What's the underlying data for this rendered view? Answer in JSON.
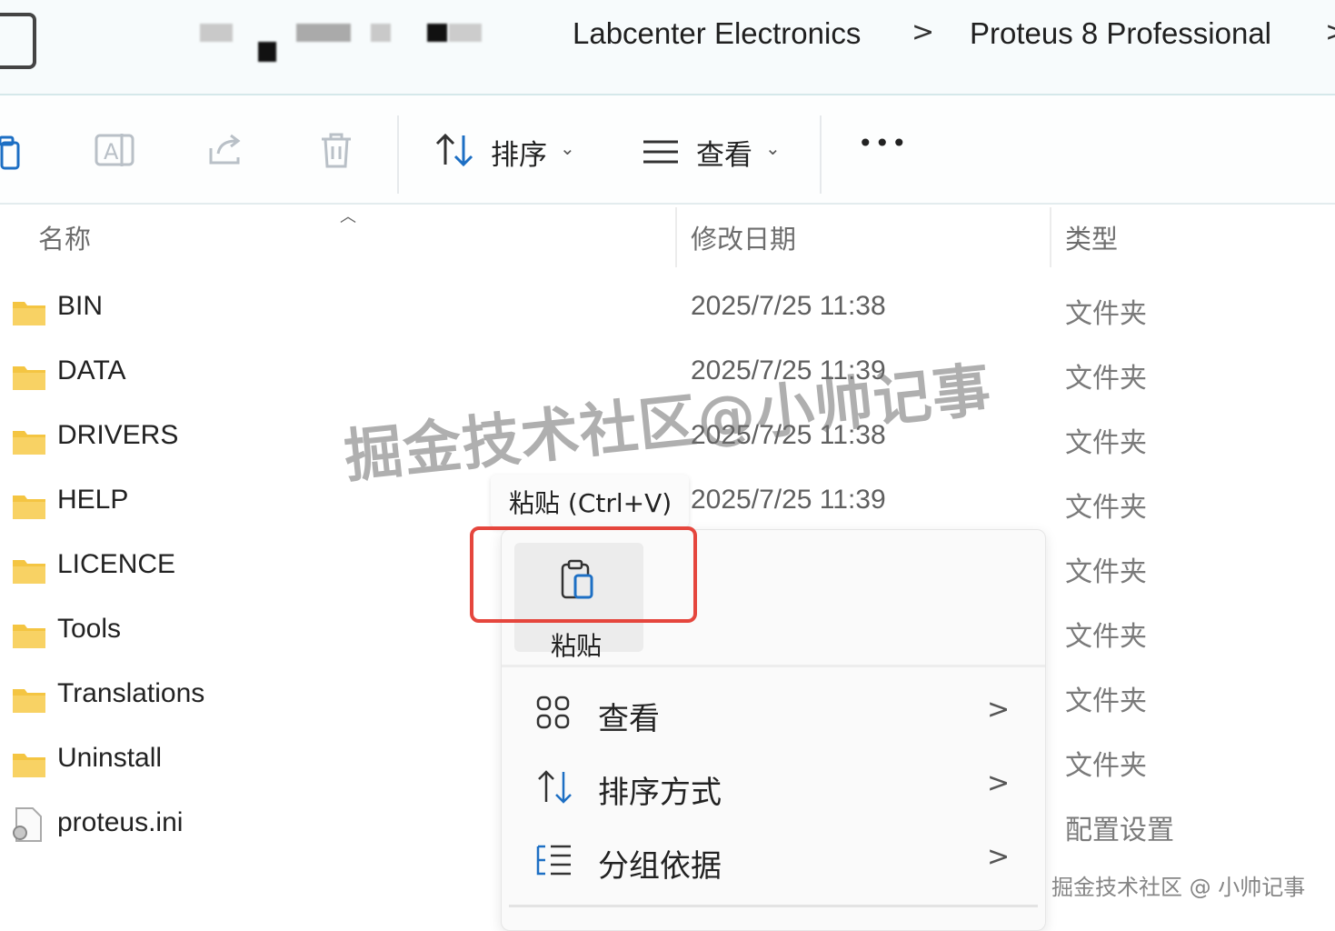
{
  "breadcrumb": {
    "items": [
      "Labcenter Electronics",
      "Proteus 8 Professional"
    ],
    "separator": ">"
  },
  "toolbar": {
    "sort_label": "排序",
    "view_label": "查看",
    "more_label": "•••"
  },
  "columns": {
    "name": "名称",
    "modified": "修改日期",
    "type": "类型"
  },
  "files": [
    {
      "name": "BIN",
      "date": "2025/7/25 11:38",
      "type": "文件夹"
    },
    {
      "name": "DATA",
      "date": "2025/7/25 11:39",
      "type": "文件夹"
    },
    {
      "name": "DRIVERS",
      "date": "2025/7/25 11:38",
      "type": "文件夹"
    },
    {
      "name": "HELP",
      "date": "2025/7/25 11:39",
      "type": "文件夹"
    },
    {
      "name": "LICENCE",
      "date": "",
      "type": "文件夹"
    },
    {
      "name": "Tools",
      "date": "",
      "type": "文件夹"
    },
    {
      "name": "Translations",
      "date": "",
      "type": "文件夹"
    },
    {
      "name": "Uninstall",
      "date": "",
      "type": "文件夹"
    },
    {
      "name": "proteus.ini",
      "date": "",
      "type": "配置设置"
    }
  ],
  "tooltip": "粘贴 (Ctrl+V)",
  "context_menu": {
    "paste_label": "粘贴",
    "items": [
      {
        "label": "查看",
        "arrow": ">"
      },
      {
        "label": "排序方式",
        "arrow": ">"
      },
      {
        "label": "分组依据",
        "arrow": ">"
      }
    ]
  },
  "watermark": {
    "main": "掘金技术社区@小帅记事",
    "corner": "掘金技术社区 @ 小帅记事"
  },
  "colors": {
    "highlight": "#e5463d",
    "folder": "#f4c542",
    "accent": "#1d6fc4"
  }
}
